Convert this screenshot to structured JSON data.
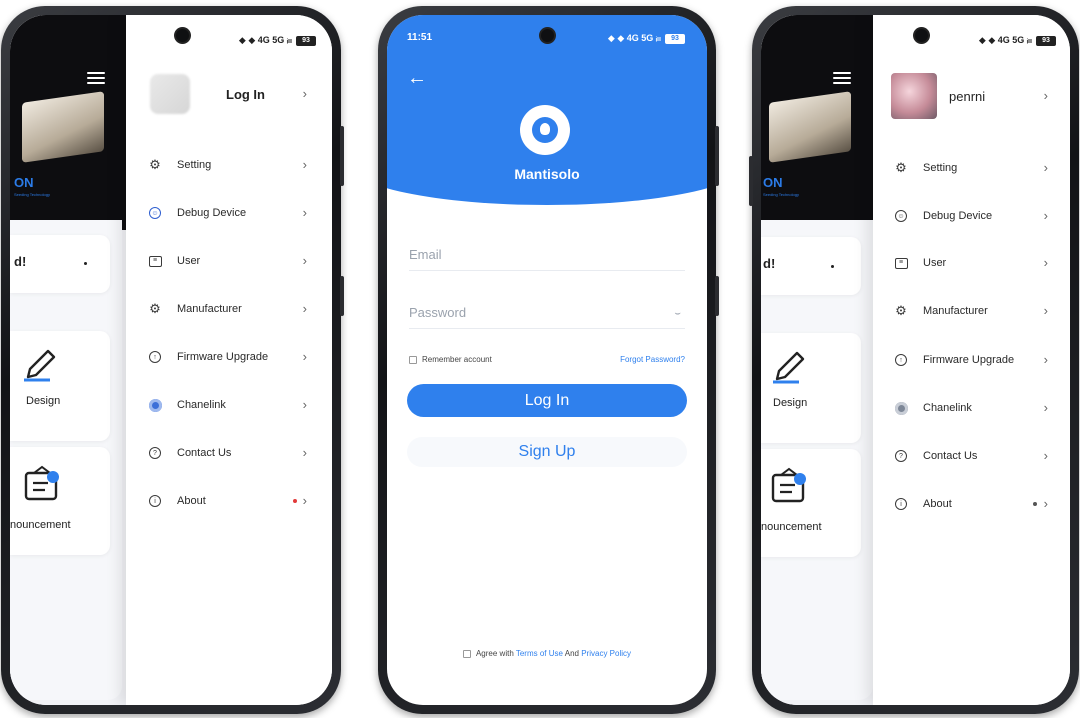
{
  "phone_left": {
    "status_icons": "◆ ◆ 4G 5G ᵢₗₗ",
    "battery": "93",
    "home": {
      "brand_cut": "ON",
      "brand_sub": "Seeding Technology",
      "card_text": "d!",
      "design_label": "Design",
      "announcement_label": "nouncement"
    },
    "drawer": {
      "profile_name": "Log In",
      "items": [
        {
          "icon": "gear-icon",
          "label": "Setting"
        },
        {
          "icon": "debug-device-icon",
          "label": "Debug Device"
        },
        {
          "icon": "user-icon",
          "label": "User"
        },
        {
          "icon": "manufacturer-icon",
          "label": "Manufacturer"
        },
        {
          "icon": "firmware-icon",
          "label": "Firmware Upgrade"
        },
        {
          "icon": "chanelink-icon",
          "label": "Chanelink"
        },
        {
          "icon": "contact-icon",
          "label": "Contact Us"
        },
        {
          "icon": "info-icon",
          "label": "About"
        }
      ]
    }
  },
  "phone_middle": {
    "time": "11:51",
    "status_icons": "◆ ◆ 4G 5G ᵢₗₗ",
    "battery": "93",
    "app_name": "Mantisolo",
    "email_placeholder": "Email",
    "password_placeholder": "Password",
    "remember_label": "Remember account",
    "forgot_label": "Forgot Password?",
    "login_label": "Log In",
    "signup_label": "Sign Up",
    "agree_prefix": "Agree with",
    "terms_label": "Terms of Use",
    "and_label": "And",
    "privacy_label": "Privacy Policy",
    "accent_color": "#2f80ed"
  },
  "phone_right": {
    "status_icons": "◆ ◆ 4G 5G ᵢₗₗ",
    "battery": "93",
    "home": {
      "brand_cut": "ON",
      "brand_sub": "Seeding Technology",
      "card_text": "d!",
      "design_label": "Design",
      "announcement_label": "nouncement"
    },
    "drawer": {
      "profile_name": "penrni",
      "items": [
        {
          "icon": "gear-icon",
          "label": "Setting"
        },
        {
          "icon": "debug-device-icon",
          "label": "Debug Device"
        },
        {
          "icon": "user-icon",
          "label": "User"
        },
        {
          "icon": "manufacturer-icon",
          "label": "Manufacturer"
        },
        {
          "icon": "firmware-icon",
          "label": "Firmware Upgrade"
        },
        {
          "icon": "chanelink-icon",
          "label": "Chanelink"
        },
        {
          "icon": "contact-icon",
          "label": "Contact Us"
        },
        {
          "icon": "info-icon",
          "label": "About"
        }
      ]
    }
  }
}
